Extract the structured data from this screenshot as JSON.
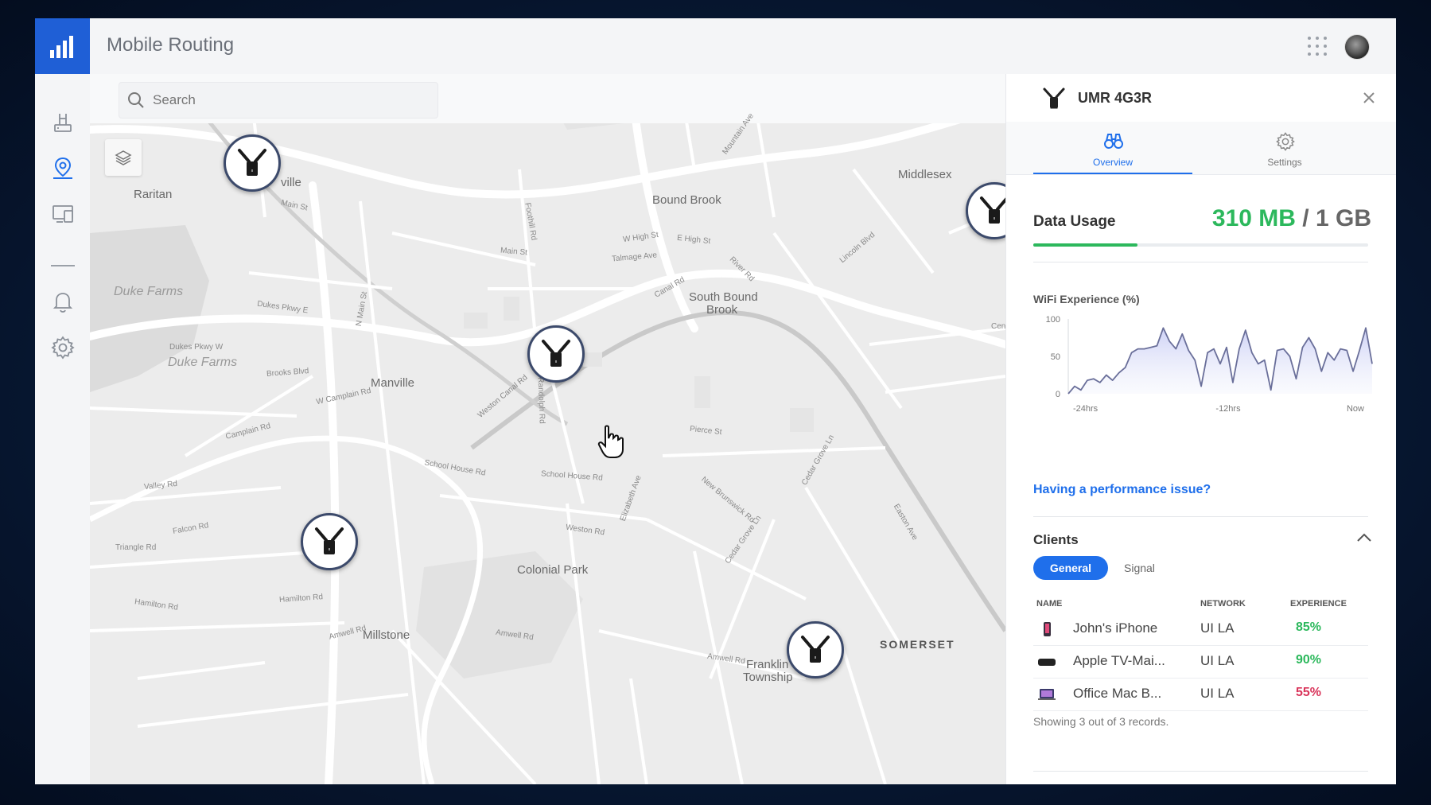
{
  "app": {
    "title": "Mobile Routing"
  },
  "search": {
    "placeholder": "Search"
  },
  "map": {
    "labels": [
      "Raritan",
      "Middlesex",
      "Bound Brook",
      "South Bound",
      "Brook",
      "Duke Farms",
      "Duke Farms",
      "Manville",
      "Colonial Park",
      "Millstone",
      "SOMERSET",
      "Franklin",
      "Township",
      "ville",
      "Main St",
      "Main St",
      "W High St",
      "E High St",
      "Talmage Ave",
      "Canal Rd",
      "River Rd",
      "Dukes Pkwy E",
      "Dukes Pkwy W",
      "Brooks Blvd",
      "W Camplain Rd",
      "Camplain Rd",
      "Valley Rd",
      "Triangle Rd",
      "Falcon Rd",
      "Hamilton Rd",
      "Hamilton Rd",
      "Amwell Rd",
      "Amwell Rd",
      "Amwell Rd",
      "Weston Rd",
      "School House Rd",
      "School House Rd",
      "Pierce St",
      "New Brunswick Rd",
      "Cedar Grove Ln",
      "Cedar Grove Ln",
      "Easton Ave",
      "Lincoln Blvd",
      "Elizabeth Ave",
      "Mountain Ave",
      "Foothill Rd",
      "Weston Canal Rd",
      "N Main St",
      "Randolph Rd",
      "Cen"
    ]
  },
  "panel": {
    "device_name": "UMR 4G3R",
    "tabs": [
      {
        "label": "Overview",
        "icon": "binoculars-icon",
        "active": true
      },
      {
        "label": "Settings",
        "icon": "gear-icon",
        "active": false
      }
    ],
    "data_usage": {
      "title": "Data Usage",
      "used": "310 MB",
      "separator": "/",
      "total": "1 GB",
      "fraction": 0.31,
      "color": "#2cb85c"
    },
    "wifi": {
      "title": "WiFi Experience (%)",
      "y_ticks": [
        "100",
        "50",
        "0"
      ],
      "x_ticks": [
        "-24hrs",
        "-12hrs",
        "Now"
      ]
    },
    "perf_link": "Having a performance issue?",
    "clients": {
      "title": "Clients",
      "filters": [
        "General",
        "Signal"
      ],
      "columns": [
        "NAME",
        "NETWORK",
        "EXPERIENCE"
      ],
      "rows": [
        {
          "name": "John's iPhone",
          "network": "UI LA",
          "experience": "85%",
          "color": "#2cb85c",
          "icon": "phone-icon"
        },
        {
          "name": "Apple TV-Mai...",
          "network": "UI LA",
          "experience": "90%",
          "color": "#2cb85c",
          "icon": "tv-icon"
        },
        {
          "name": "Office Mac B...",
          "network": "UI LA",
          "experience": "55%",
          "color": "#d9345a",
          "icon": "laptop-icon"
        }
      ],
      "footer": "Showing 3 out of 3 records."
    }
  },
  "chart_data": {
    "type": "area",
    "title": "WiFi Experience (%)",
    "x_tick_labels": [
      "-24hrs",
      "-12hrs",
      "Now"
    ],
    "ylim": [
      0,
      100
    ],
    "y_ticks": [
      0,
      50,
      100
    ],
    "x": [
      0,
      1,
      2,
      3,
      4,
      5,
      6,
      7,
      8,
      9,
      10,
      11,
      12,
      13,
      14,
      15,
      16,
      17,
      18,
      19,
      20,
      21,
      22,
      23,
      24,
      25,
      26,
      27,
      28,
      29,
      30,
      31,
      32,
      33,
      34,
      35,
      36,
      37,
      38,
      39,
      40,
      41,
      42,
      43,
      44,
      45,
      46,
      47,
      48
    ],
    "values": [
      0,
      10,
      5,
      18,
      20,
      15,
      25,
      18,
      28,
      35,
      55,
      60,
      60,
      62,
      64,
      88,
      70,
      60,
      80,
      58,
      45,
      10,
      55,
      60,
      40,
      62,
      15,
      60,
      85,
      55,
      40,
      45,
      5,
      58,
      60,
      50,
      20,
      62,
      75,
      60,
      30,
      55,
      45,
      60,
      58,
      30,
      58,
      88,
      40
    ],
    "series": [
      {
        "name": "",
        "values": []
      }
    ]
  }
}
